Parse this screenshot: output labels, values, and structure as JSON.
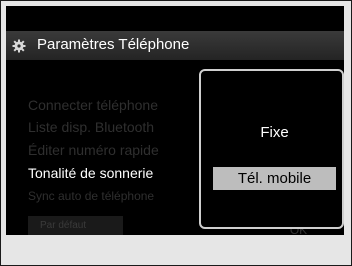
{
  "title": "Paramètres Téléphone",
  "menu": [
    {
      "label": "Connecter téléphone"
    },
    {
      "label": "Liste disp. Bluetooth"
    },
    {
      "label": "Éditer numéro rapide"
    },
    {
      "label": "Tonalité de sonnerie"
    },
    {
      "label": "Sync auto de téléphone"
    }
  ],
  "default_button": "Par défaut",
  "ok_button": "OK",
  "popup": {
    "options": [
      {
        "label": "Fixe"
      },
      {
        "label": "Tél. mobile"
      }
    ],
    "selected": "Tél. mobile"
  },
  "colors": {
    "accent": "#bdbdbd",
    "background": "#000000"
  }
}
